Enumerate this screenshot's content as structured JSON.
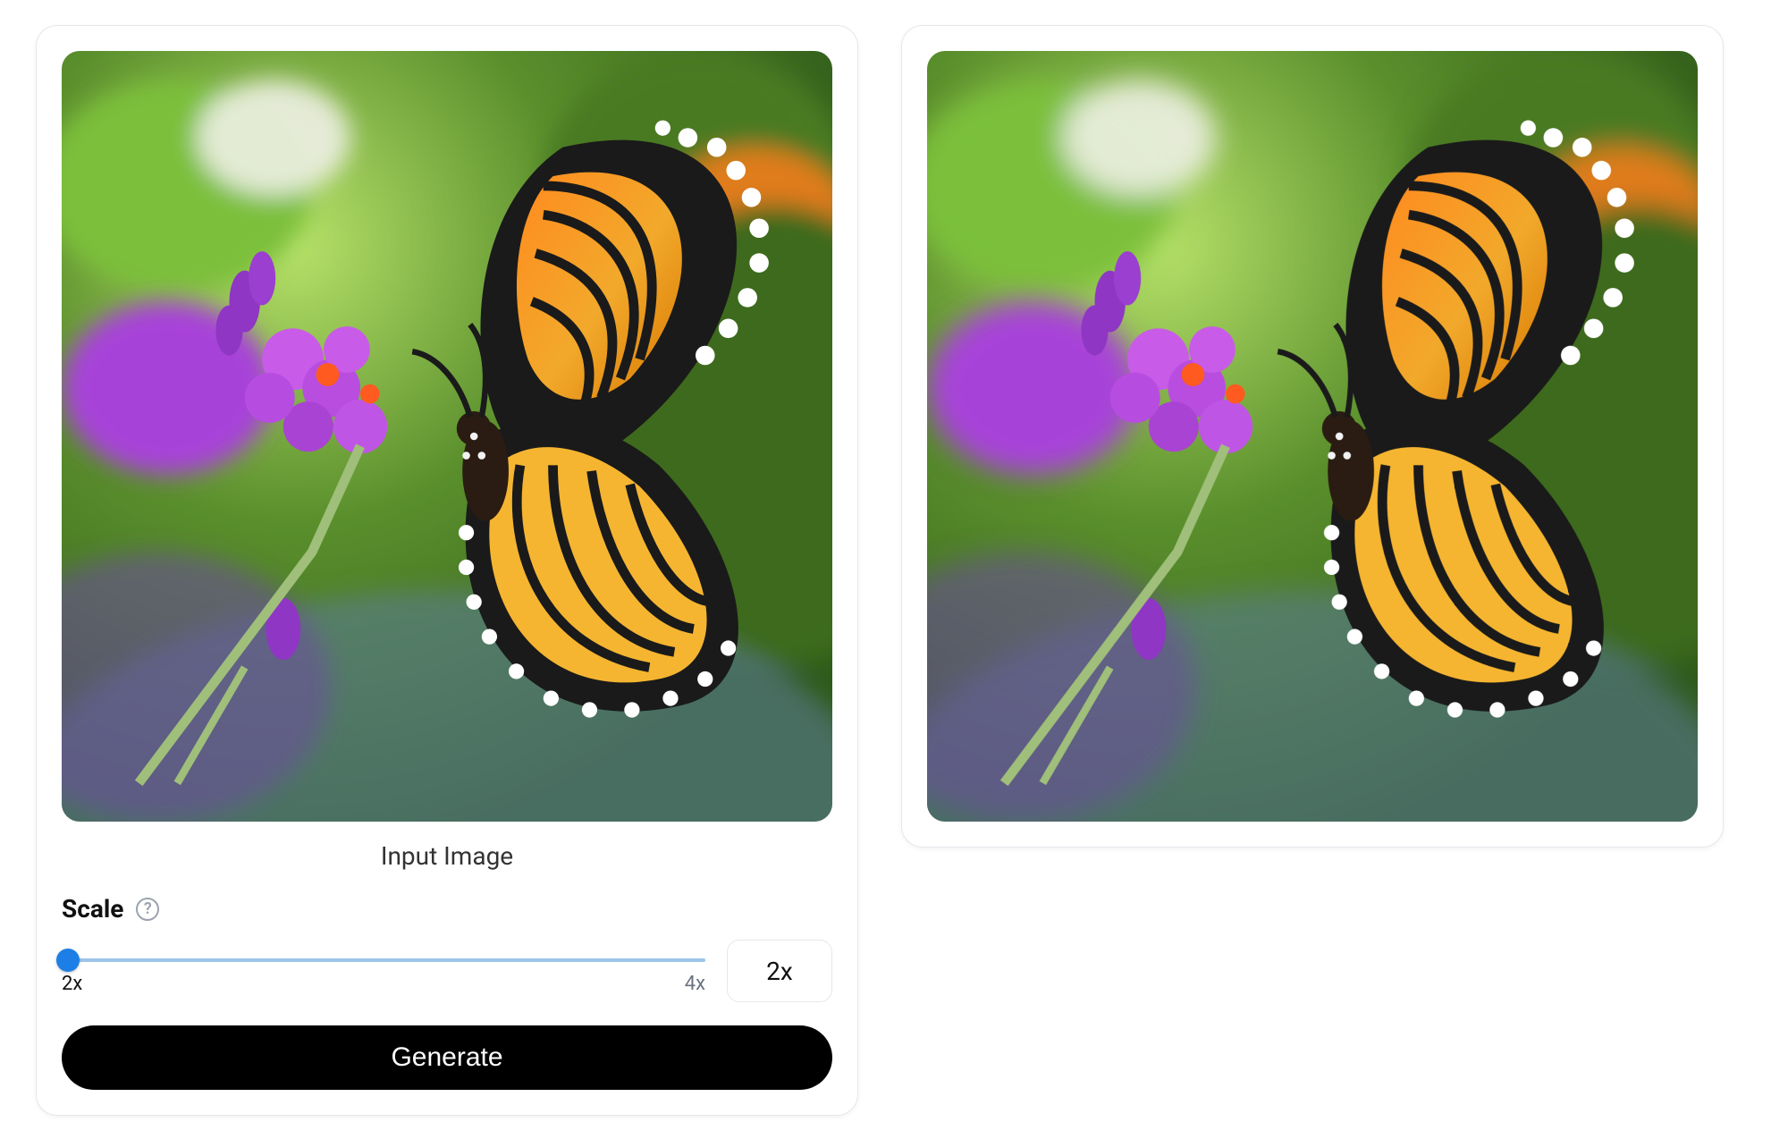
{
  "input": {
    "caption": "Input Image",
    "image_alt": "Monarch butterfly on purple flowers"
  },
  "output": {
    "image_alt": "Upscaled monarch butterfly on purple flowers"
  },
  "scale": {
    "label": "Scale",
    "help_glyph": "?",
    "min_label": "2x",
    "max_label": "4x",
    "value_display": "2x",
    "slider_percent": 0
  },
  "actions": {
    "generate_label": "Generate"
  }
}
